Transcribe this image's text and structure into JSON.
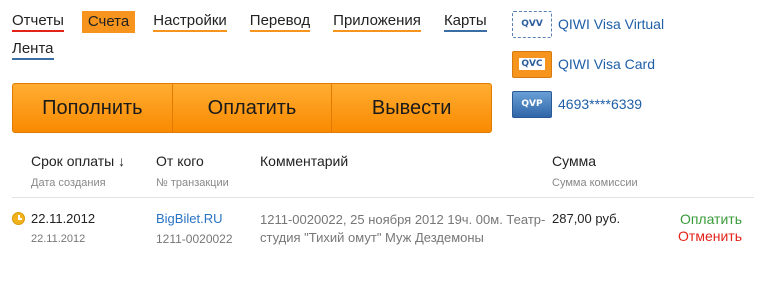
{
  "nav": {
    "items": [
      {
        "label": "Отчеты"
      },
      {
        "label": "Счета"
      },
      {
        "label": "Настройки"
      },
      {
        "label": "Перевод"
      },
      {
        "label": "Приложения"
      },
      {
        "label": "Карты"
      },
      {
        "label": "Лента"
      }
    ],
    "active": "Счета"
  },
  "actions": {
    "topup": "Пополнить",
    "pay": "Оплатить",
    "withdraw": "Вывести"
  },
  "cards": [
    {
      "icon_text": "QVV",
      "label": "QIWI Visa Virtual"
    },
    {
      "icon_text": "QVC",
      "label": "QIWI Visa Card"
    },
    {
      "icon_text": "QVP",
      "label": "4693****6339"
    }
  ],
  "table": {
    "headers": {
      "due": "Срок оплаты ↓",
      "due_sub": "Дата создания",
      "from": "От кого",
      "from_sub": "№ транзакции",
      "comment": "Комментарий",
      "amount": "Сумма",
      "amount_sub": "Сумма комиссии"
    },
    "rows": [
      {
        "due_date": "22.11.2012",
        "created": "22.11.2012",
        "from": "BigBilet.RU",
        "tx": "1211-0020022",
        "comment": "1211-0020022, 25 ноября 2012 19ч. 00м. Театр-студия \"Тихий омут\" Муж Дездемоны",
        "amount": "287,00 руб.",
        "pay_label": "Оплатить",
        "cancel_label": "Отменить"
      }
    ]
  },
  "colors": {
    "accent": "#f7941d",
    "link": "#2a73c4",
    "pay": "#3a9a3a",
    "cancel": "#e2231a"
  }
}
